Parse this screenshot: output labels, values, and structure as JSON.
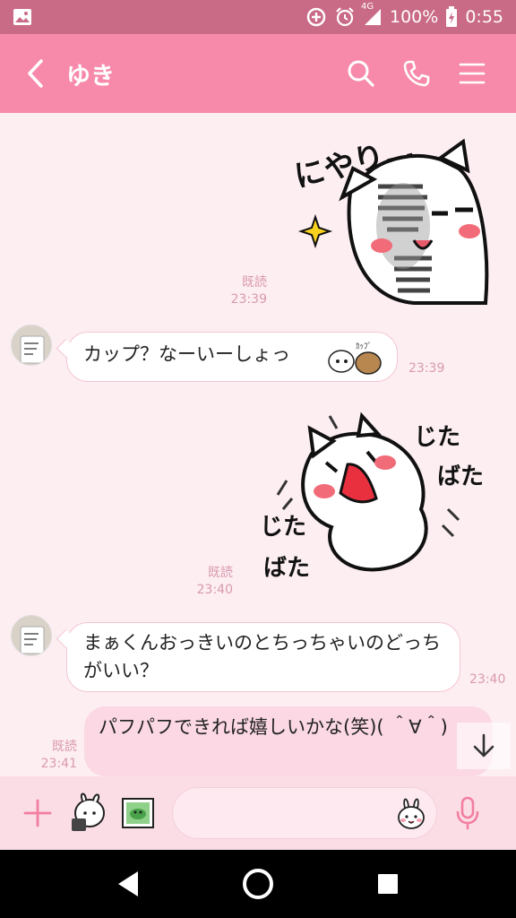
{
  "status": {
    "network": "4G",
    "battery": "100%",
    "time": "0:55"
  },
  "header": {
    "title": "ゆき"
  },
  "messages": {
    "m1": {
      "read": "既読",
      "time": "23:39"
    },
    "m2": {
      "text": "カップ？なーいーしょっ",
      "time": "23:39"
    },
    "m3": {
      "read": "既読",
      "time": "23:40"
    },
    "m4": {
      "text": "まぁくんおっきいのとちっちゃいのどっちがいい？",
      "time": "23:40"
    },
    "m5": {
      "text": "パフパフできれば嬉しいかな(笑)( ＾∀＾)",
      "read": "既読",
      "time": "23:41"
    }
  },
  "stickers": {
    "s1": "にやり…",
    "s2a": "じた",
    "s2b": "ばた",
    "s2c": "じた",
    "s2d": "ばた"
  },
  "input": {
    "placeholder": ""
  },
  "colors": {
    "header": "#f78aaa",
    "statusbar": "#c96a86",
    "chat_bg": "#fdeef2",
    "bubble_out": "#fbd8e3"
  }
}
